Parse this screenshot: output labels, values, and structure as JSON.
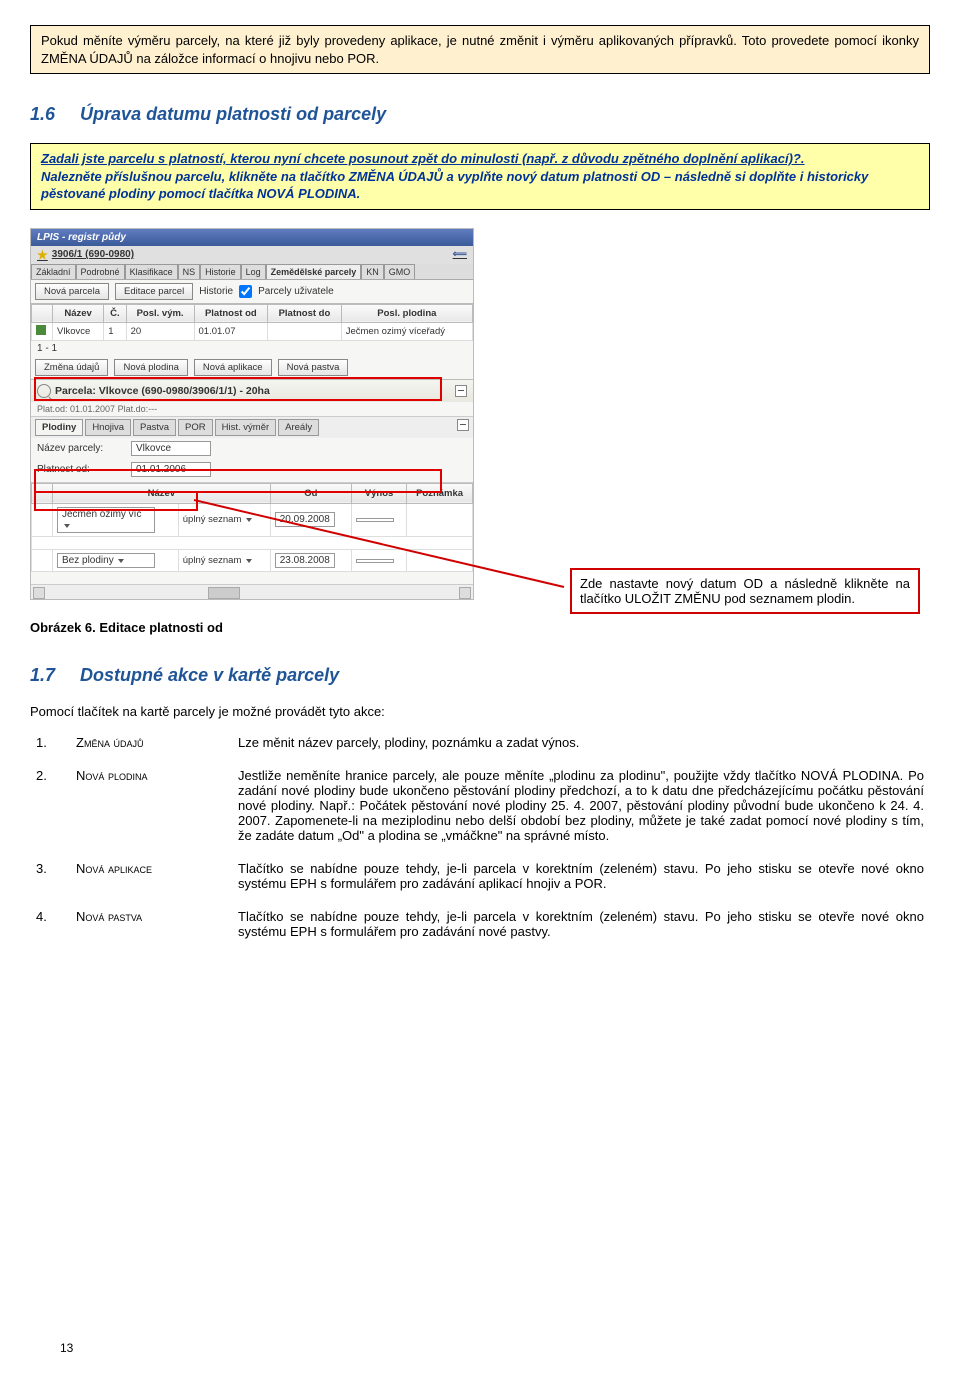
{
  "infoBox": {
    "text": "Pokud měníte výměru parcely, na které již byly provedeny aplikace, je nutné změnit i výměru aplikovaných přípravků. Toto provedete pomocí ikonky ZMĚNA ÚDAJŮ na záložce informací o hnojivu nebo POR."
  },
  "section16": {
    "num": "1.6",
    "title": "Úprava datumu platnosti od parcely"
  },
  "yellowBox": {
    "line1": "Zadali jste parcelu s platností, kterou nyní chcete posunout zpět do minulosti (např. z důvodu zpětného doplnění aplikací)?.",
    "line2": "Nalezněte příslušnou parcelu, klikněte na tlačítko ZMĚNA ÚDAJŮ a vyplňte nový datum platnosti OD – následně si doplňte i historicky pěstované plodiny pomocí tlačítka NOVÁ PLODINA."
  },
  "screenshot": {
    "appTitle": "LPIS - registr půdy",
    "ownerLink": "3906/1 (690-0980)",
    "tabs": [
      "Základní",
      "Podrobné",
      "Klasifikace",
      "NS",
      "Historie",
      "Log",
      "Zemědělské parcely",
      "KN",
      "GMO"
    ],
    "activeTab": "Zemědělské parcely",
    "buttons1": {
      "novaParcela": "Nová parcela",
      "editaceParcel": "Editace parcel",
      "historie": "Historie",
      "parcelyUzivatele": "Parcely uživatele"
    },
    "columns": [
      "Název",
      "Č.",
      "Posl. vým.",
      "Platnost od",
      "Platnost do",
      "Posl. plodina"
    ],
    "row1": {
      "nazev": "Vlkovce",
      "c": "1",
      "vym": "20",
      "od": "01.01.07",
      "do": "",
      "plodina": "Ječmen ozimý víceřadý"
    },
    "rangeLabel": "1 - 1",
    "buttons2": {
      "zmenaUdaju": "Změna údajů",
      "novaPlodina": "Nová plodina",
      "novaAplikace": "Nová aplikace",
      "novaPastva": "Nová pastva"
    },
    "parcelaHeader": "Parcela: Vlkovce (690-0980/3906/1/1) - 20ha",
    "platLine": "Plat.od: 01.01.2007 Plat.do:---",
    "subtabs": [
      "Plodiny",
      "Hnojiva",
      "Pastva",
      "POR",
      "Hist. výměr",
      "Areály"
    ],
    "activeSubtab": "Plodiny",
    "nazevParcelyLabel": "Název parcely:",
    "nazevParcelyValue": "Vlkovce",
    "platnostOdLabel": "Platnost od:",
    "platnostOdValue": "01.01.2006",
    "cropCols": [
      "Název",
      "Od",
      "Výnos",
      "Poznámka"
    ],
    "cropRows": [
      {
        "nazev": "Ječmen ozimý víc",
        "seznam": "úplný seznam",
        "od": "20.09.2008"
      },
      {
        "nazev": "Bez plodiny",
        "seznam": "úplný seznam",
        "od": "23.08.2008"
      }
    ]
  },
  "callout": {
    "text": "Zde nastavte nový datum OD a následně klikněte na tlačítko ULOŽIT ZMĚNU pod seznamem plodin."
  },
  "figCaption": "Obrázek 6. Editace platnosti od",
  "section17": {
    "num": "1.7",
    "title": "Dostupné akce v kartě parcely",
    "intro": "Pomocí tlačítek na kartě parcely je možné provádět tyto akce:"
  },
  "actions": [
    {
      "num": "1.",
      "label": "Změna údajů",
      "desc": "Lze měnit název parcely, plodiny, poznámku a zadat výnos."
    },
    {
      "num": "2.",
      "label": "Nová plodina",
      "desc": "Jestliže neměníte hranice parcely, ale pouze měníte „plodinu za plodinu\", použijte vždy tlačítko NOVÁ PLODINA. Po zadání nové plodiny bude ukončeno pěstování plodiny předchozí, a to k datu dne předcházejícímu počátku pěstování nové plodiny. Např.: Počátek pěstování nové plodiny 25. 4. 2007, pěstování plodiny původní bude ukončeno k 24. 4. 2007. Zapomenete-li na meziplodinu nebo delší období bez plodiny, můžete je také zadat pomocí nové plodiny s tím, že zadáte datum „Od\" a plodina se „vmáčkne\" na správné místo."
    },
    {
      "num": "3.",
      "label": "Nová aplikace",
      "desc": "Tlačítko se nabídne pouze tehdy, je-li parcela v korektním (zeleném) stavu. Po jeho stisku se otevře nové okno systému EPH s formulářem pro zadávání aplikací hnojiv a POR."
    },
    {
      "num": "4.",
      "label": "Nová pastva",
      "desc": "Tlačítko se nabídne pouze tehdy, je-li parcela v korektním (zeleném) stavu. Po jeho stisku se otevře nové okno systému EPH s formulářem pro zadávání nové pastvy."
    }
  ],
  "pageNumber": "13"
}
